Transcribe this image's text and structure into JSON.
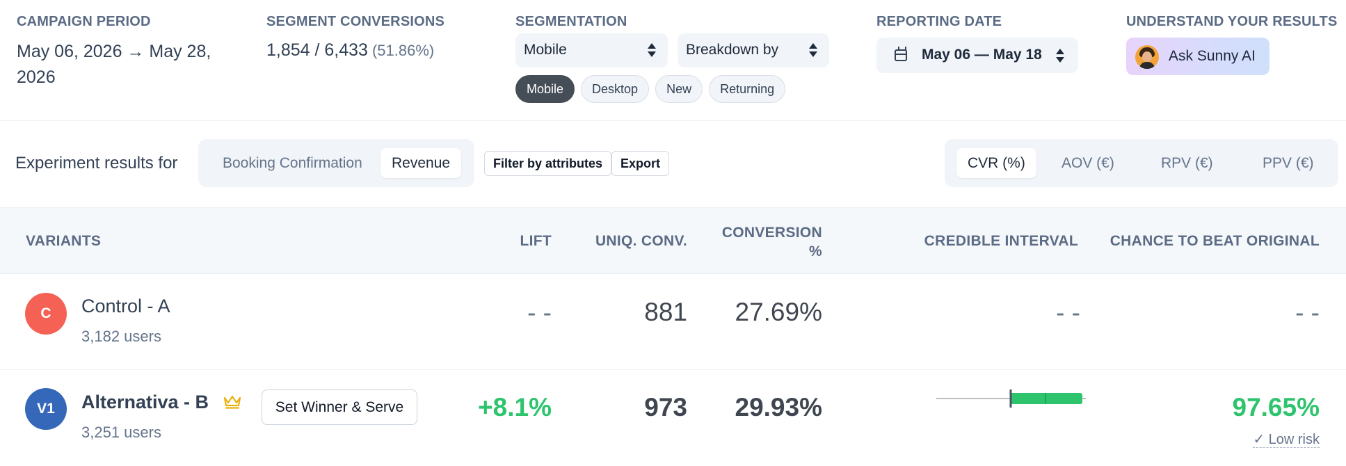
{
  "summary": {
    "campaign_period": {
      "label": "CAMPAIGN PERIOD",
      "value": "May 06, 2026 → May 28, 2026"
    },
    "segment_conversions": {
      "label": "SEGMENT CONVERSIONS",
      "value": "1,854 / 6,433",
      "percent": "(51.86%)"
    },
    "segmentation": {
      "label": "SEGMENTATION",
      "select_value": "Mobile",
      "breakdown_value": "Breakdown by",
      "chips": [
        "Mobile",
        "Desktop",
        "New",
        "Returning"
      ],
      "active_chip": "Mobile"
    },
    "reporting_date": {
      "label": "REPORTING DATE",
      "value": "May 06 — May 18"
    },
    "ai": {
      "label": "UNDERSTAND YOUR RESULTS",
      "button": "Ask Sunny AI"
    }
  },
  "toolbar": {
    "results_for": "Experiment results for",
    "goal_tabs": [
      "Booking Confirmation",
      "Revenue"
    ],
    "active_goal": "Revenue",
    "filter_button": "Filter by attributes",
    "export_button": "Export",
    "metric_tabs": [
      "CVR (%)",
      "AOV (€)",
      "RPV (€)",
      "PPV (€)"
    ],
    "active_metric": "CVR (%)"
  },
  "table": {
    "headers": {
      "variants": "VARIANTS",
      "lift": "LIFT",
      "uniq_conv": "UNIQ. CONV.",
      "conversion_line1": "CONVERSION",
      "conversion_line2": "%",
      "credible_interval": "CREDIBLE INTERVAL",
      "chance": "CHANCE TO BEAT ORIGINAL"
    },
    "rows": [
      {
        "badge": "C",
        "badge_color": "#f56255",
        "name": "Control - A",
        "users": "3,182 users",
        "lift": "- -",
        "uniq_conv": "881",
        "conversion": "27.69%",
        "credible_interval": "- -",
        "chance": "- -"
      },
      {
        "badge": "V1",
        "badge_color": "#3568b8",
        "name": "Alternativa - B",
        "winner_icon": "crown-icon",
        "users": "3,251 users",
        "action": "Set Winner & Serve",
        "lift": "+8.1%",
        "uniq_conv": "973",
        "conversion": "29.93%",
        "chance": "97.65%",
        "risk": "✓ Low risk"
      }
    ]
  },
  "colors": {
    "positive": "#2ec46d",
    "interval_bar": "#2ec46d",
    "header_text": "#5b6b84"
  }
}
